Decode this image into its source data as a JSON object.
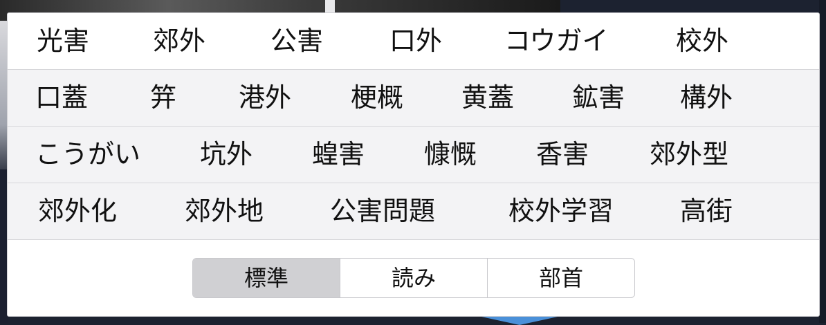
{
  "candidates": {
    "row1": [
      "光害",
      "郊外",
      "公害",
      "口外",
      "コウガイ",
      "校外"
    ],
    "row2": [
      "口蓋",
      "笄",
      "港外",
      "梗概",
      "黄蓋",
      "鉱害",
      "構外"
    ],
    "row3": [
      "こうがい",
      "坑外",
      "蝗害",
      "慷慨",
      "香害",
      "郊外型"
    ],
    "row4": [
      "郊外化",
      "郊外地",
      "公害問題",
      "校外学習",
      "高街"
    ]
  },
  "segmented_control": {
    "options": [
      "標準",
      "読み",
      "部首"
    ],
    "selected": "標準"
  },
  "colors": {
    "panel_bg": "#ffffff",
    "shaded_row_bg": "#f3f3f5",
    "selected_segment_bg": "#d0d0d3",
    "accent": "#4a90d9"
  }
}
